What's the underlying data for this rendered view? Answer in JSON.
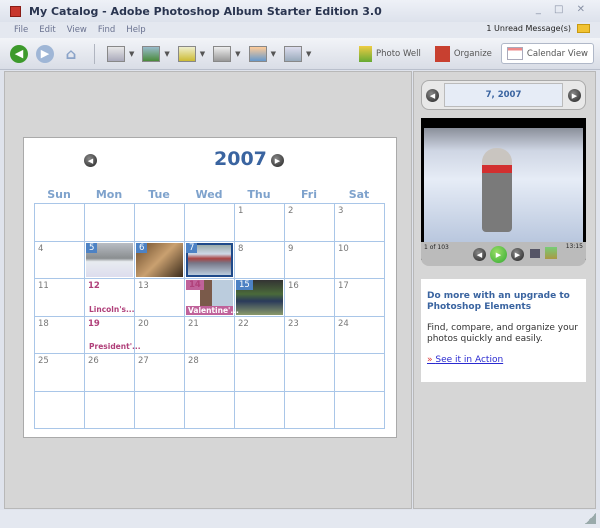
{
  "window": {
    "title": "My Catalog - Adobe Photoshop Album Starter Edition 3.0",
    "controls": "_ □ ✕"
  },
  "menu": [
    "File",
    "Edit",
    "View",
    "Find",
    "Help"
  ],
  "messages": "1 Unread Message(s)",
  "toolbar": {
    "photo_well": "Photo Well",
    "organize": "Organize",
    "calendar_view": "Calendar View"
  },
  "calendar": {
    "year": "2007",
    "days_of_week": [
      "Sun",
      "Mon",
      "Tue",
      "Wed",
      "Thu",
      "Fri",
      "Sat"
    ],
    "weeks": [
      [
        null,
        null,
        null,
        null,
        {
          "d": "1"
        },
        {
          "d": "2"
        },
        {
          "d": "3"
        }
      ],
      [
        {
          "d": "4"
        },
        {
          "d": "5",
          "photo": "snow"
        },
        {
          "d": "6",
          "photo": "indoor"
        },
        {
          "d": "7",
          "photo": "girl",
          "selected": true
        },
        {
          "d": "8"
        },
        {
          "d": "9"
        },
        {
          "d": "10"
        }
      ],
      [
        {
          "d": "11"
        },
        {
          "d": "12",
          "event": "Lincoln's..."
        },
        {
          "d": "13"
        },
        {
          "d": "14",
          "photo": "portrait",
          "event": "Valentine'..."
        },
        {
          "d": "15",
          "photo": "park"
        },
        {
          "d": "16"
        },
        {
          "d": "17"
        }
      ],
      [
        {
          "d": "18"
        },
        {
          "d": "19",
          "event": "President'..."
        },
        {
          "d": "20"
        },
        {
          "d": "21"
        },
        {
          "d": "22"
        },
        {
          "d": "23"
        },
        {
          "d": "24"
        }
      ],
      [
        {
          "d": "25"
        },
        {
          "d": "26"
        },
        {
          "d": "27"
        },
        {
          "d": "28"
        },
        null,
        null,
        null
      ],
      [
        null,
        null,
        null,
        null,
        null,
        null,
        null
      ]
    ]
  },
  "side": {
    "date": "7, 2007",
    "counter": "1 of 103",
    "time": "13:15",
    "ad_title": "Do more with an upgrade to Photoshop Elements",
    "ad_text": "Find, compare, and organize your photos quickly and easily.",
    "ad_link": "See it in Action"
  }
}
